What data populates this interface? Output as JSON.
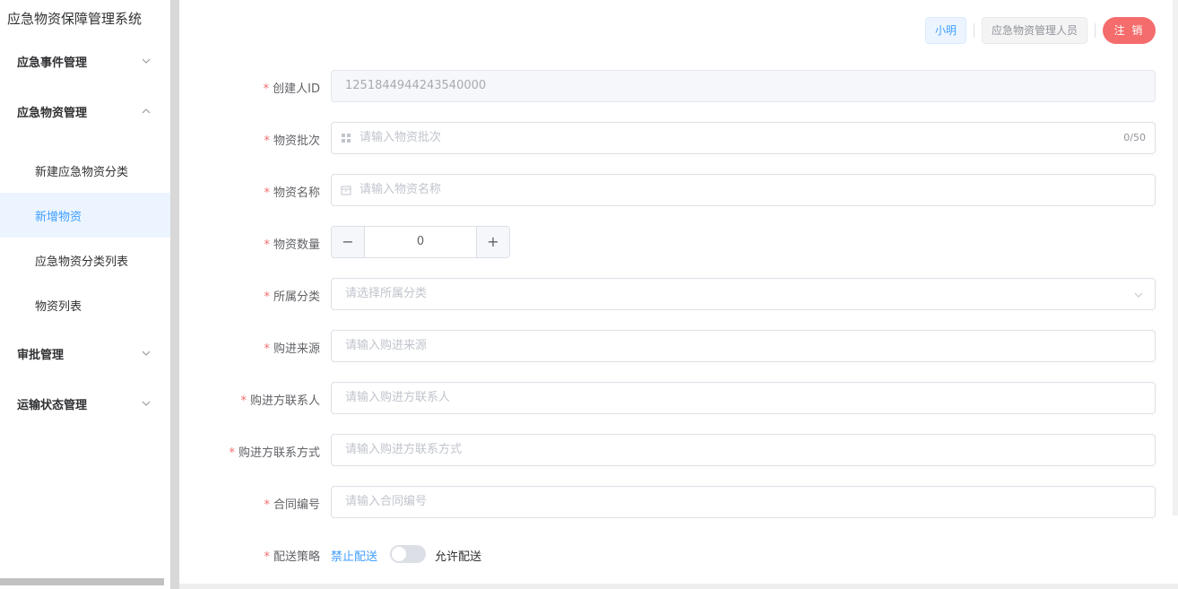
{
  "app": {
    "title": "应急物资保障管理系统"
  },
  "sidebar": {
    "groups": [
      {
        "label": "应急事件管理",
        "expanded": false
      },
      {
        "label": "应急物资管理",
        "expanded": true
      },
      {
        "label": "审批管理",
        "expanded": false
      },
      {
        "label": "运输状态管理",
        "expanded": false
      }
    ],
    "items": [
      {
        "label": "新建应急物资分类",
        "active": false
      },
      {
        "label": "新增物资",
        "active": true
      },
      {
        "label": "应急物资分类列表",
        "active": false
      },
      {
        "label": "物资列表",
        "active": false
      }
    ]
  },
  "header": {
    "user": "小明",
    "role": "应急物资管理人员",
    "logout": "注 销"
  },
  "form": {
    "creator_id": {
      "label": "创建人ID",
      "value": "1251844944243540000",
      "required": true
    },
    "batch": {
      "label": "物资批次",
      "placeholder": "请输入物资批次",
      "count": "0/50",
      "required": true
    },
    "name": {
      "label": "物资名称",
      "placeholder": "请输入物资名称",
      "required": true
    },
    "quantity": {
      "label": "物资数量",
      "value": "0",
      "minus": "−",
      "plus": "+",
      "required": true
    },
    "category": {
      "label": "所属分类",
      "placeholder": "请选择所属分类",
      "required": true
    },
    "source": {
      "label": "购进来源",
      "placeholder": "请输入购进来源",
      "required": true
    },
    "contact": {
      "label": "购进方联系人",
      "placeholder": "请输入购进方联系人",
      "required": true
    },
    "contact_method": {
      "label": "购进方联系方式",
      "placeholder": "请输入购进方联系方式",
      "required": true
    },
    "contract_no": {
      "label": "合同编号",
      "placeholder": "请输入合同编号",
      "required": true
    },
    "delivery": {
      "label": "配送策略",
      "inactive_text": "禁止配送",
      "active_text": "允许配送",
      "enabled": false,
      "required": true
    }
  },
  "colors": {
    "primary": "#409eff",
    "danger": "#f56c6c",
    "active_bg": "#ecf5ff"
  }
}
